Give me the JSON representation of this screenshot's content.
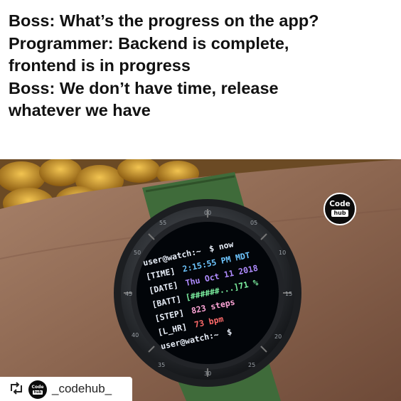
{
  "caption": {
    "lines": [
      "Boss: What’s the progress on the app?",
      "Programmer: Backend is complete,",
      "frontend is in progress",
      "Boss: We don’t have time, release",
      "whatever we have"
    ]
  },
  "watch": {
    "terminal": [
      {
        "label": "user@watch:~",
        "value": "$ now"
      },
      {
        "label": "[TIME]",
        "value": "2:15:55 PM MDT"
      },
      {
        "label": "[DATE]",
        "value": "Thu Oct 11 2018"
      },
      {
        "label": "[BATT]",
        "value": "[######...]71 %"
      },
      {
        "label": "[STEP]",
        "value": "823 steps"
      },
      {
        "label": "[L_HR]",
        "value": "73 bpm"
      },
      {
        "label": "user@watch:~",
        "value": "$"
      }
    ],
    "bezel_numbers": [
      "55",
      "00",
      "05",
      "10",
      "15",
      "20",
      "25",
      "30",
      "35",
      "40",
      "45",
      "50"
    ],
    "colors": {
      "prompt": "#e8eef8",
      "time": "#6ec6ff",
      "date": "#b08cff",
      "batt": "#7cf0a0",
      "step": "#ffa6d8",
      "hr": "#ff6a6a",
      "screen": "#020509"
    }
  },
  "logo": {
    "line1": "Code",
    "line2": "hub"
  },
  "credit": {
    "icon": "retweet-icon",
    "handle": "_codehub_"
  }
}
